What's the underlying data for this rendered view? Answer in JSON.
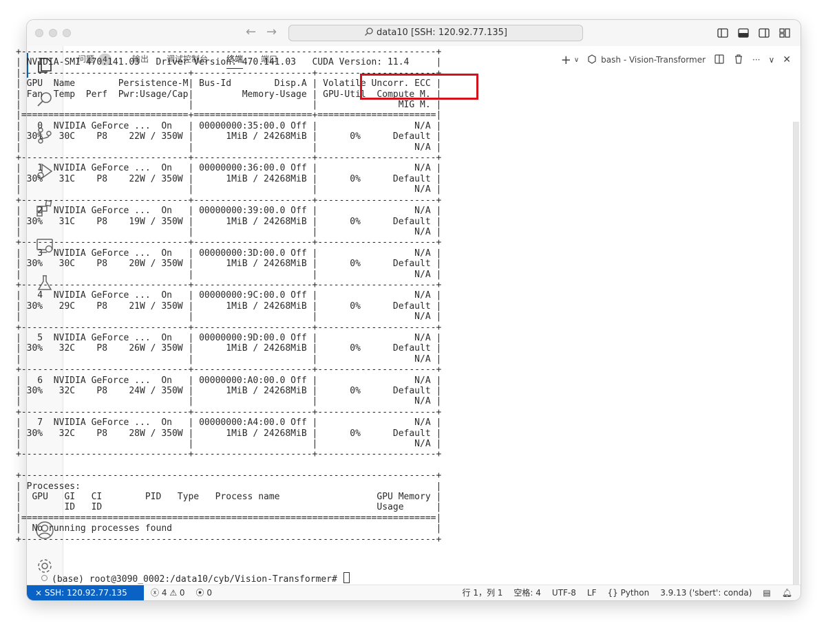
{
  "window": {
    "title": "data10 [SSH: 120.92.77.135]"
  },
  "panel_tabs": [
    {
      "label": "问题",
      "badge": "4"
    },
    {
      "label": "输出"
    },
    {
      "label": "调试控制台"
    },
    {
      "label": "终端"
    },
    {
      "label": "端口"
    }
  ],
  "terminal_header": {
    "shell_label": "bash - Vision-Transformer"
  },
  "terminal": {
    "lines": [
      "+-----------------------------------------------------------------------------+",
      "| NVIDIA-SMI 470.141.03   Driver Version: 470.141.03   CUDA Version: 11.4     |",
      "|-------------------------------+----------------------+----------------------+",
      "| GPU  Name        Persistence-M| Bus-Id        Disp.A | Volatile Uncorr. ECC |",
      "| Fan  Temp  Perf  Pwr:Usage/Cap|         Memory-Usage | GPU-Util  Compute M. |",
      "|                               |                      |               MIG M. |",
      "|===============================+======================+======================|",
      "|   0  NVIDIA GeForce ...  On   | 00000000:35:00.0 Off |                  N/A |",
      "| 30%   30C    P8    22W / 350W |      1MiB / 24268MiB |      0%      Default |",
      "|                               |                      |                  N/A |",
      "+-------------------------------+----------------------+----------------------+",
      "|   1  NVIDIA GeForce ...  On   | 00000000:36:00.0 Off |                  N/A |",
      "| 30%   31C    P8    22W / 350W |      1MiB / 24268MiB |      0%      Default |",
      "|                               |                      |                  N/A |",
      "+-------------------------------+----------------------+----------------------+",
      "|   2  NVIDIA GeForce ...  On   | 00000000:39:00.0 Off |                  N/A |",
      "| 30%   31C    P8    19W / 350W |      1MiB / 24268MiB |      0%      Default |",
      "|                               |                      |                  N/A |",
      "+-------------------------------+----------------------+----------------------+",
      "|   3  NVIDIA GeForce ...  On   | 00000000:3D:00.0 Off |                  N/A |",
      "| 30%   30C    P8    20W / 350W |      1MiB / 24268MiB |      0%      Default |",
      "|                               |                      |                  N/A |",
      "+-------------------------------+----------------------+----------------------+",
      "|   4  NVIDIA GeForce ...  On   | 00000000:9C:00.0 Off |                  N/A |",
      "| 30%   29C    P8    21W / 350W |      1MiB / 24268MiB |      0%      Default |",
      "|                               |                      |                  N/A |",
      "+-------------------------------+----------------------+----------------------+",
      "|   5  NVIDIA GeForce ...  On   | 00000000:9D:00.0 Off |                  N/A |",
      "| 30%   32C    P8    26W / 350W |      1MiB / 24268MiB |      0%      Default |",
      "|                               |                      |                  N/A |",
      "+-------------------------------+----------------------+----------------------+",
      "|   6  NVIDIA GeForce ...  On   | 00000000:A0:00.0 Off |                  N/A |",
      "| 30%   32C    P8    24W / 350W |      1MiB / 24268MiB |      0%      Default |",
      "|                               |                      |                  N/A |",
      "+-------------------------------+----------------------+----------------------+",
      "|   7  NVIDIA GeForce ...  On   | 00000000:A4:00.0 Off |                  N/A |",
      "| 30%   32C    P8    28W / 350W |      1MiB / 24268MiB |      0%      Default |",
      "|                               |                      |                  N/A |",
      "+-------------------------------+----------------------+----------------------+",
      "",
      "+-----------------------------------------------------------------------------+",
      "| Processes:                                                                  |",
      "|  GPU   GI   CI        PID   Type   Process name                  GPU Memory |",
      "|        ID   ID                                                   Usage      |",
      "|=============================================================================|",
      "|  No running processes found                                                 |",
      "+-----------------------------------------------------------------------------+"
    ],
    "prompt": "(base) root@3090_0002:/data10/cyb/Vision-Transformer# "
  },
  "statusbar": {
    "remote": "SSH: 120.92.77.135",
    "errors": "4",
    "warnings": "0",
    "ports": "0",
    "position": "行 1，列 1",
    "spaces": "空格: 4",
    "encoding": "UTF-8",
    "eol": "LF",
    "language": "Python",
    "interpreter": "3.9.13 ('sbert': conda)"
  },
  "colors": {
    "accent": "#0a63c4",
    "highlight": "#d4121b"
  },
  "icons": {
    "activity": [
      "explorer-icon",
      "search-icon",
      "source-control-icon",
      "run-debug-icon",
      "extensions-icon",
      "remote-explorer-icon",
      "testing-icon",
      "account-icon",
      "settings-gear-icon"
    ]
  }
}
